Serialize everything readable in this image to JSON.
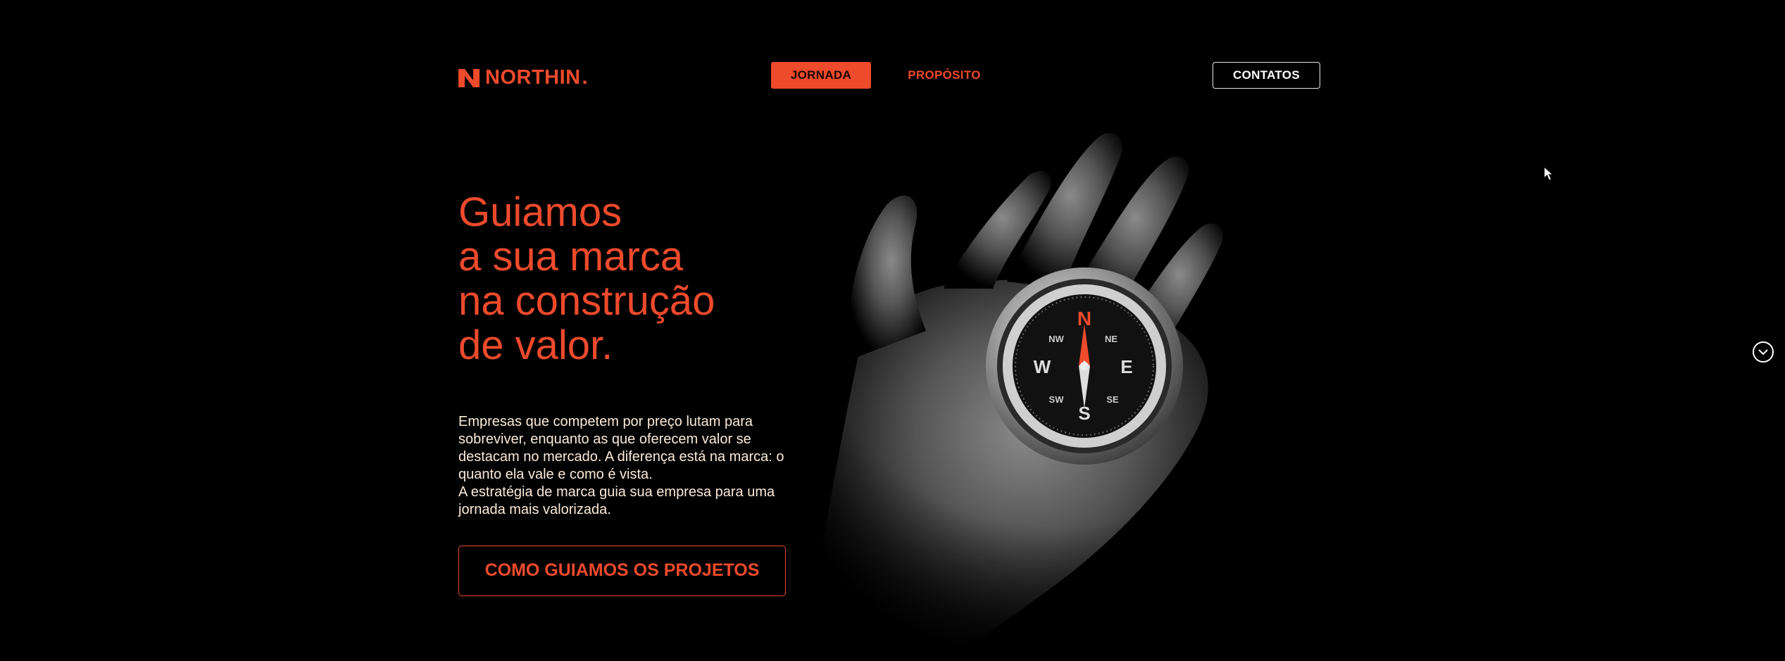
{
  "brand": {
    "name": "NORTHIN",
    "accent_color": "#ee4a2c",
    "logo_icon": "n-logo-icon"
  },
  "nav": {
    "items": [
      {
        "label": "JORNADA",
        "active": true
      },
      {
        "label": "PROPÓSITO",
        "active": false
      }
    ],
    "contact_label": "CONTATOS"
  },
  "hero": {
    "headline_lines": [
      "Guiamos",
      "a sua marca",
      "na construção",
      "de valor."
    ],
    "body_paragraphs": [
      "Empresas que competem por preço lutam para sobreviver, enquanto as que oferecem valor se destacam no mercado. A diferença está na marca: o quanto ela vale e como é vista.",
      "A estratégia de marca guia sua empresa para uma jornada mais valorizada."
    ],
    "cta_label": "COMO GUIAMOS OS PROJETOS",
    "image": "hand-holding-compass",
    "compass_labels": {
      "north": "N",
      "northeast": "NE",
      "east": "E",
      "southeast": "SE",
      "south": "S",
      "southwest": "SW",
      "west": "W",
      "northwest": "NW"
    }
  },
  "scroll": {
    "icon": "chevron-down-circle-icon"
  }
}
